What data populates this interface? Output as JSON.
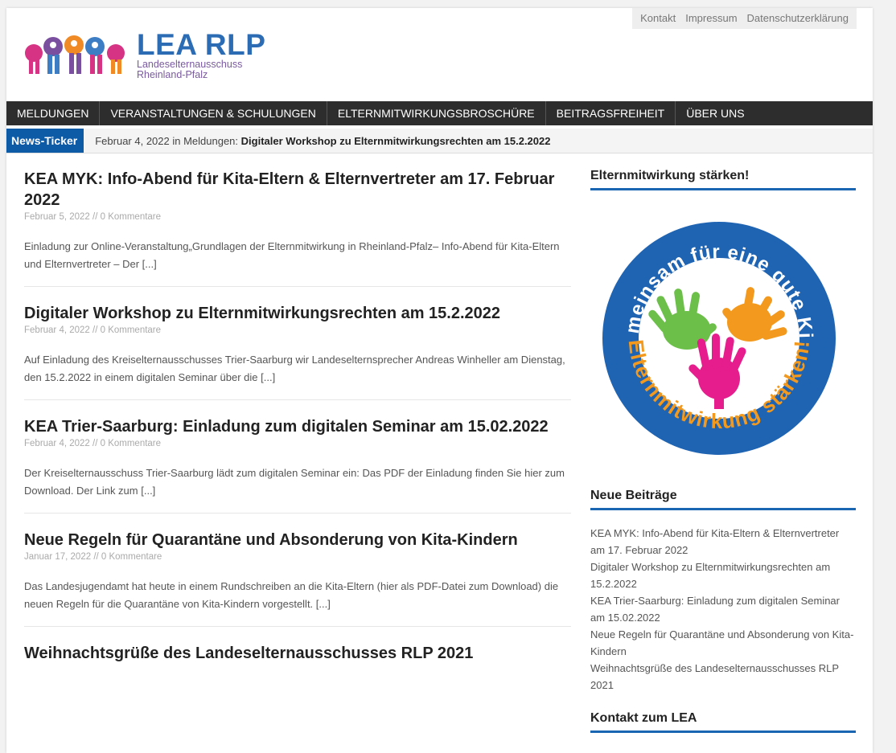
{
  "header": {
    "topnav": [
      "Kontakt",
      "Impressum",
      "Datenschutzerklärung"
    ],
    "logo_title": "LEA RLP",
    "logo_sub1": "Landeselternausschuss",
    "logo_sub2": "Rheinland-Pfalz"
  },
  "nav": [
    "MELDUNGEN",
    "VERANSTALTUNGEN & SCHULUNGEN",
    "ELTERNMITWIRKUNGSBROSCHÜRE",
    "BEITRAGSFREIHEIT",
    "ÜBER UNS"
  ],
  "ticker": {
    "label": "News-Ticker",
    "prefix": "Februar 4, 2022 in Meldungen:",
    "headline": "Digitaler Workshop zu Elternmitwirkungsrechten am 15.2.2022"
  },
  "posts": [
    {
      "title": "KEA MYK: Info-Abend für Kita-Eltern & Elternvertreter am 17. Februar 2022",
      "meta": "Februar 5, 2022 // 0 Kommentare",
      "excerpt": "Einladung zur Online-Veranstaltung„Grundlagen der Elternmitwirkung in Rheinland-Pfalz– Info-Abend für Kita-Eltern und Elternvertreter – Der [...]"
    },
    {
      "title": "Digitaler Workshop zu Elternmitwirkungsrechten am 15.2.2022",
      "meta": "Februar 4, 2022 // 0 Kommentare",
      "excerpt": "Auf Einladung des Kreiselternausschusses Trier-Saarburg wir Landeselternsprecher Andreas Winheller am Dienstag, den 15.2.2022 in einem digitalen Seminar über die [...]"
    },
    {
      "title": "KEA Trier-Saarburg: Einladung zum digitalen Seminar am 15.02.2022",
      "meta": "Februar 4, 2022 // 0 Kommentare",
      "excerpt": "Der Kreiselternausschuss Trier-Saarburg lädt zum digitalen Seminar ein: Das PDF der Einladung finden Sie hier zum Download. Der Link zum [...]"
    },
    {
      "title": "Neue Regeln für Quarantäne und Absonderung von Kita-Kindern",
      "meta": "Januar 17, 2022 // 0 Kommentare",
      "excerpt": "Das Landesjugendamt hat heute in einem Rundschreiben an die Kita-Eltern (hier als PDF-Datei zum Download) die neuen Regeln für die Quarantäne von Kita-Kindern vorgestellt. [...]"
    },
    {
      "title": "Weihnachtsgrüße des Landeselternausschusses RLP 2021",
      "meta": "",
      "excerpt": ""
    }
  ],
  "sidebar": {
    "widget1_title": "Elternmitwirkung stärken!",
    "badge_top": "Gemeinsam für eine gute KiTa",
    "badge_bottom": "Elternmitwirkung stärken!",
    "widget2_title": "Neue Beiträge",
    "recent": [
      "KEA MYK: Info-Abend für Kita-Eltern & Elternvertreter am 17. Februar 2022",
      "Digitaler Workshop zu Elternmitwirkungsrechten am 15.2.2022",
      "KEA Trier-Saarburg: Einladung zum digitalen Seminar am 15.02.2022",
      "Neue Regeln für Quarantäne und Absonderung von Kita-Kindern",
      "Weihnachtsgrüße des Landeselternausschusses RLP 2021"
    ],
    "widget3_title": "Kontakt zum LEA"
  },
  "colors": {
    "brand_blue": "#2b6cb5",
    "ticker_blue": "#0d5aa7",
    "nav_bg": "#2d2d2d"
  }
}
